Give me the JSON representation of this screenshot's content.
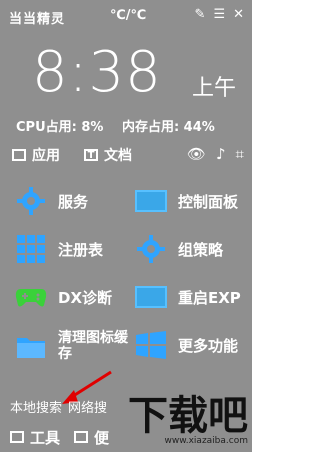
{
  "header": {
    "title": "当当精灵",
    "unit": "℃/℃",
    "icons": [
      "pin-icon",
      "menu-icon",
      "close-icon"
    ]
  },
  "clock": {
    "time": "8:38",
    "ampm": "上午"
  },
  "stats": {
    "cpu": "CPU占用: 8%",
    "mem": "内存占用: 44%"
  },
  "tabs": [
    {
      "label": "应用"
    },
    {
      "label": "文档"
    }
  ],
  "tools": [
    "eye-icon",
    "music-icon",
    "crop-icon"
  ],
  "grid": {
    "items": [
      {
        "label": "服务",
        "icon": "gear-icon"
      },
      {
        "label": "控制面板",
        "icon": "monitor-icon"
      },
      {
        "label": "注册表",
        "icon": "grid-icon"
      },
      {
        "label": "组策略",
        "icon": "gear-icon"
      },
      {
        "label": "DX诊断",
        "icon": "gamepad-icon"
      },
      {
        "label": "重启EXP",
        "icon": "monitor-icon"
      },
      {
        "label": "清理图标缓存",
        "icon": "folder-icon"
      },
      {
        "label": "更多功能",
        "icon": "windows-icon"
      }
    ]
  },
  "bottom": {
    "search": "本地搜索",
    "net": "网络搜",
    "tools": "工具",
    "more": "便"
  },
  "watermark": {
    "big": "下载吧",
    "small": "www.xiazaiba.com"
  },
  "colors": {
    "accent": "#2fa4ff",
    "background": "#8f8f8f",
    "highlight": "#e00000"
  }
}
